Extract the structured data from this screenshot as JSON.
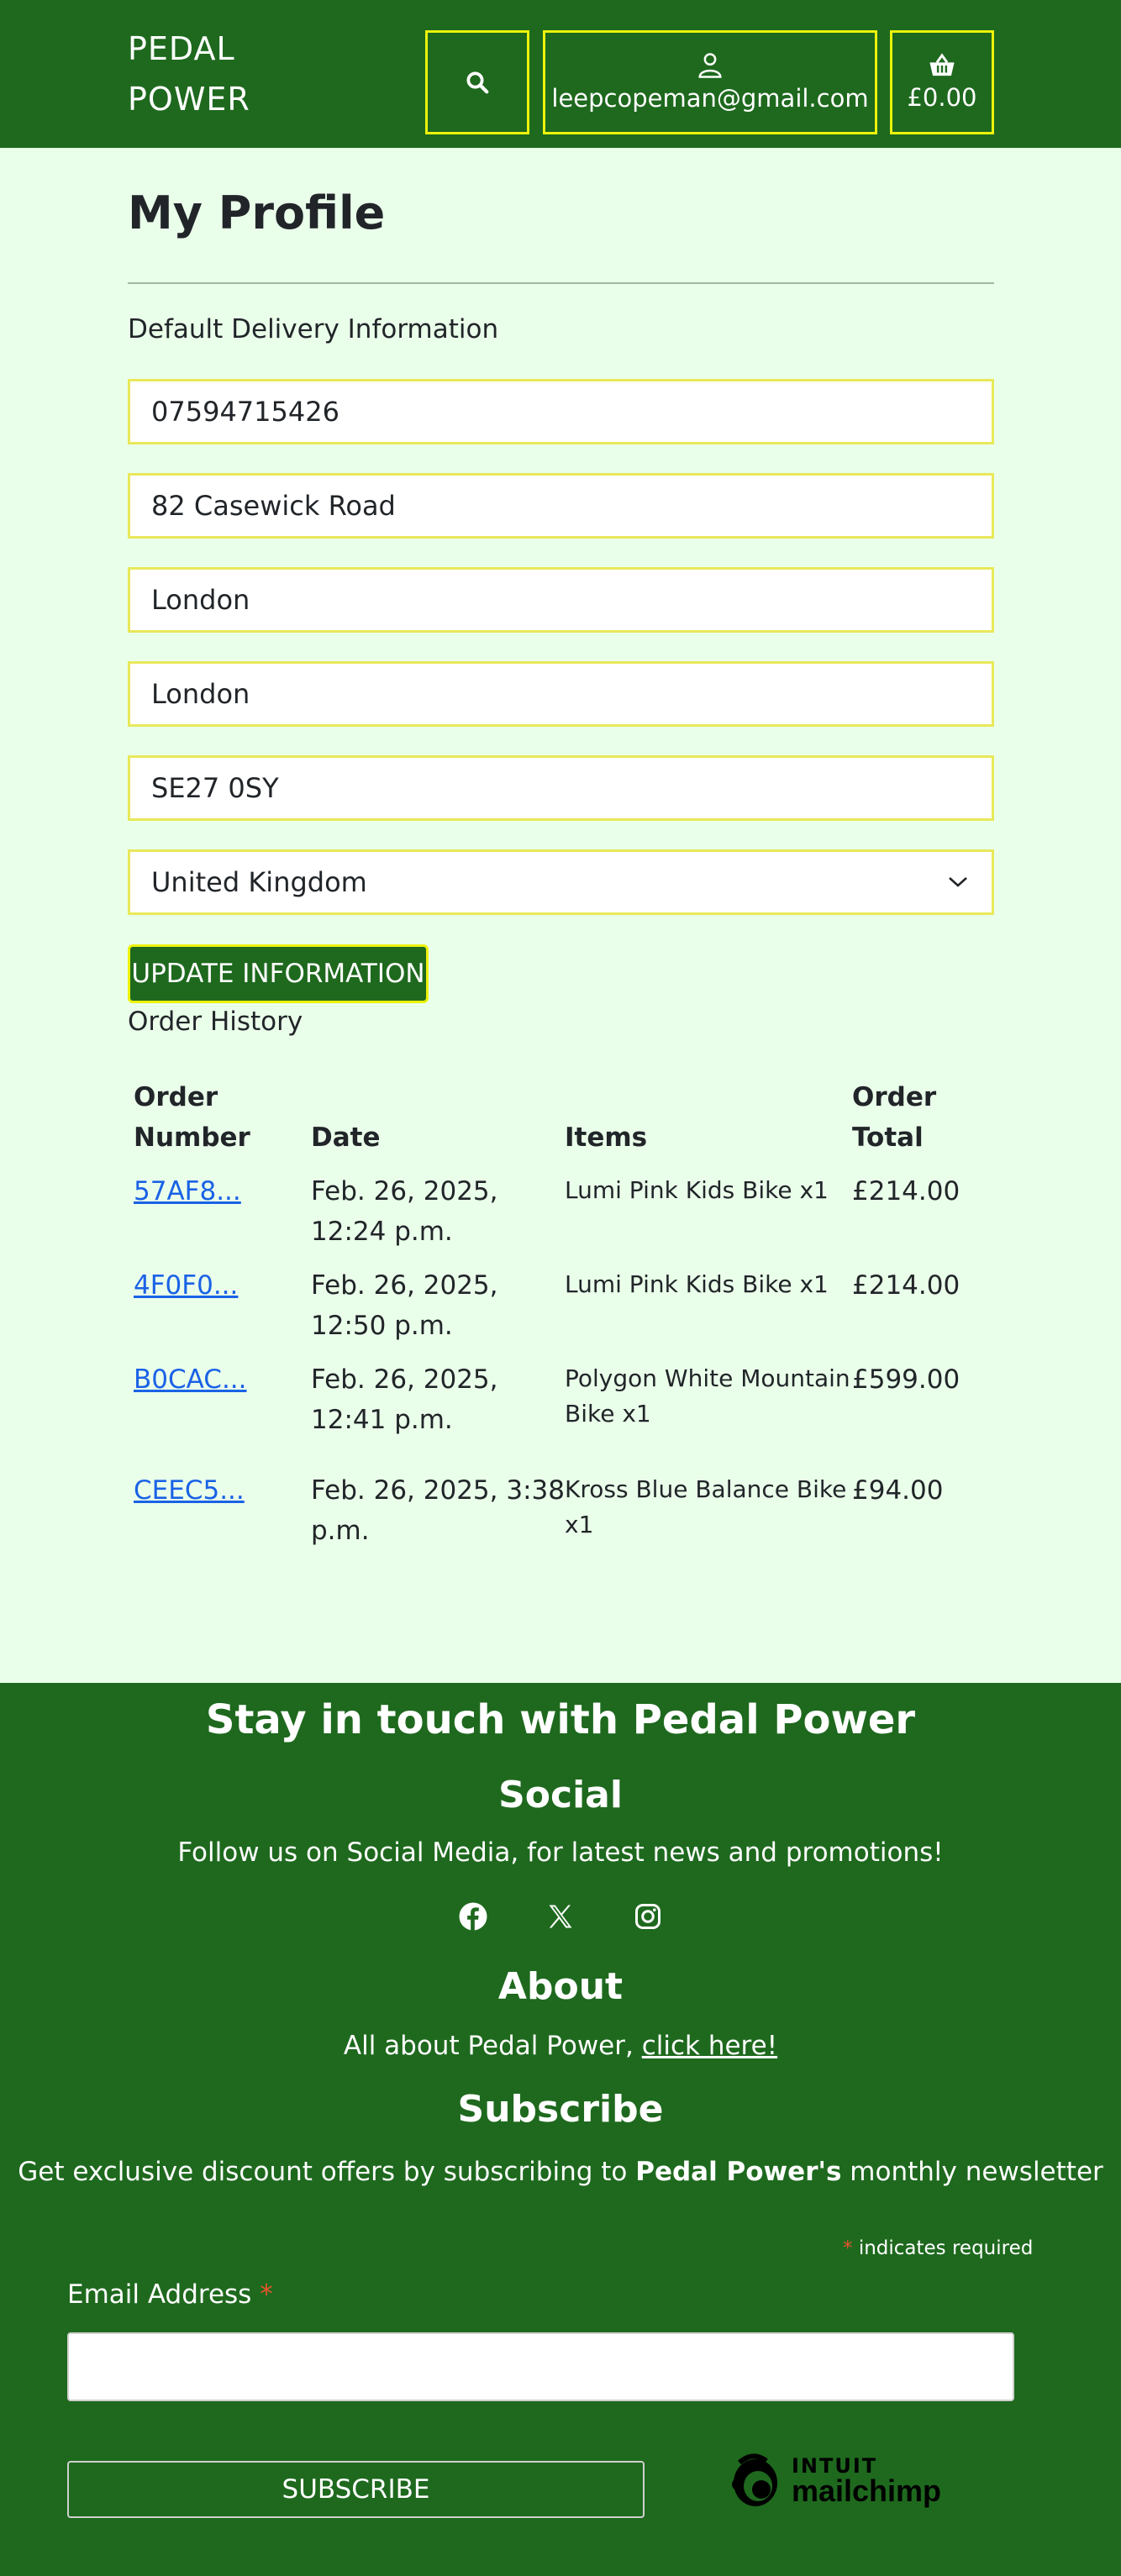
{
  "header": {
    "brand_line1": "PEDAL",
    "brand_line2": "POWER",
    "account_email": "leepcopeman@gmail.com",
    "basket_total": "£0.00",
    "icons": {
      "search": "search-icon",
      "account": "user-icon",
      "basket": "basket-icon"
    }
  },
  "profile": {
    "title": "My Profile",
    "delivery_heading": "Default Delivery Information",
    "fields": {
      "phone": "07594715426",
      "street": "82 Casewick Road",
      "town": "London",
      "county": "London",
      "postcode": "SE27 0SY",
      "country": "United Kingdom"
    },
    "update_label": "UPDATE INFORMATION"
  },
  "orders": {
    "heading": "Order History",
    "columns": {
      "number_line1": "Order",
      "number_line2": "Number",
      "date": "Date",
      "items": "Items",
      "total_line1": "Order",
      "total_line2": "Total"
    },
    "rows": [
      {
        "number": "57AF8...",
        "date_line1": "Feb. 26, 2025,",
        "date_line2": "12:24 p.m.",
        "items_line1": "Lumi Pink Kids Bike x1",
        "items_line2": "",
        "total": "£214.00"
      },
      {
        "number": "4F0F0...",
        "date_line1": "Feb. 26, 2025,",
        "date_line2": "12:50 p.m.",
        "items_line1": "Lumi Pink Kids Bike x1",
        "items_line2": "",
        "total": "£214.00"
      },
      {
        "number": "B0CAC...",
        "date_line1": "Feb. 26, 2025,",
        "date_line2": "12:41 p.m.",
        "items_line1": "Polygon White Mountain",
        "items_line2": "Bike x1",
        "total": "£599.00"
      },
      {
        "number": "CEEC5...",
        "date_line1": "Feb. 26, 2025, 3:38",
        "date_line2": "p.m.",
        "items_line1": "Kross Blue Balance Bike",
        "items_line2": "x1",
        "total": "£94.00"
      }
    ]
  },
  "footer": {
    "title": "Stay in touch with Pedal Power",
    "social_heading": "Social",
    "social_text": "Follow us on Social Media, for latest news and promotions!",
    "social_icons": [
      "facebook-icon",
      "x-icon",
      "instagram-icon"
    ],
    "about_heading": "About",
    "about_text": "All about Pedal Power,",
    "about_link": "click here!",
    "subscribe_heading": "Subscribe",
    "subscribe_text_before": "Get exclusive discount offers by subscribing to",
    "subscribe_text_bold": "Pedal Power's",
    "subscribe_text_after": "monthly newsletter",
    "required_star": "*",
    "required_note": "indicates required",
    "email_label": "Email Address",
    "subscribe_button": "SUBSCRIBE",
    "mc_intuit": "INTUIT",
    "mc_mailchimp": "mailchimp"
  },
  "colors": {
    "header_green": "#1e691e",
    "page_background": "#eaffea",
    "focus_yellow": "#ecf20a",
    "link_blue": "#1a62e6"
  }
}
